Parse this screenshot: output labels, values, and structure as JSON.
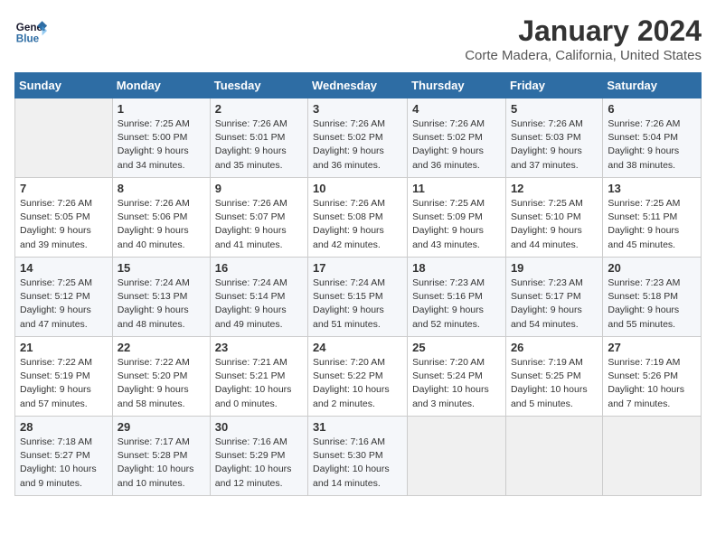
{
  "header": {
    "logo_line1": "General",
    "logo_line2": "Blue",
    "month": "January 2024",
    "location": "Corte Madera, California, United States"
  },
  "days_of_week": [
    "Sunday",
    "Monday",
    "Tuesday",
    "Wednesday",
    "Thursday",
    "Friday",
    "Saturday"
  ],
  "weeks": [
    [
      {
        "num": "",
        "detail": ""
      },
      {
        "num": "1",
        "detail": "Sunrise: 7:25 AM\nSunset: 5:00 PM\nDaylight: 9 hours\nand 34 minutes."
      },
      {
        "num": "2",
        "detail": "Sunrise: 7:26 AM\nSunset: 5:01 PM\nDaylight: 9 hours\nand 35 minutes."
      },
      {
        "num": "3",
        "detail": "Sunrise: 7:26 AM\nSunset: 5:02 PM\nDaylight: 9 hours\nand 36 minutes."
      },
      {
        "num": "4",
        "detail": "Sunrise: 7:26 AM\nSunset: 5:02 PM\nDaylight: 9 hours\nand 36 minutes."
      },
      {
        "num": "5",
        "detail": "Sunrise: 7:26 AM\nSunset: 5:03 PM\nDaylight: 9 hours\nand 37 minutes."
      },
      {
        "num": "6",
        "detail": "Sunrise: 7:26 AM\nSunset: 5:04 PM\nDaylight: 9 hours\nand 38 minutes."
      }
    ],
    [
      {
        "num": "7",
        "detail": "Sunrise: 7:26 AM\nSunset: 5:05 PM\nDaylight: 9 hours\nand 39 minutes."
      },
      {
        "num": "8",
        "detail": "Sunrise: 7:26 AM\nSunset: 5:06 PM\nDaylight: 9 hours\nand 40 minutes."
      },
      {
        "num": "9",
        "detail": "Sunrise: 7:26 AM\nSunset: 5:07 PM\nDaylight: 9 hours\nand 41 minutes."
      },
      {
        "num": "10",
        "detail": "Sunrise: 7:26 AM\nSunset: 5:08 PM\nDaylight: 9 hours\nand 42 minutes."
      },
      {
        "num": "11",
        "detail": "Sunrise: 7:25 AM\nSunset: 5:09 PM\nDaylight: 9 hours\nand 43 minutes."
      },
      {
        "num": "12",
        "detail": "Sunrise: 7:25 AM\nSunset: 5:10 PM\nDaylight: 9 hours\nand 44 minutes."
      },
      {
        "num": "13",
        "detail": "Sunrise: 7:25 AM\nSunset: 5:11 PM\nDaylight: 9 hours\nand 45 minutes."
      }
    ],
    [
      {
        "num": "14",
        "detail": "Sunrise: 7:25 AM\nSunset: 5:12 PM\nDaylight: 9 hours\nand 47 minutes."
      },
      {
        "num": "15",
        "detail": "Sunrise: 7:24 AM\nSunset: 5:13 PM\nDaylight: 9 hours\nand 48 minutes."
      },
      {
        "num": "16",
        "detail": "Sunrise: 7:24 AM\nSunset: 5:14 PM\nDaylight: 9 hours\nand 49 minutes."
      },
      {
        "num": "17",
        "detail": "Sunrise: 7:24 AM\nSunset: 5:15 PM\nDaylight: 9 hours\nand 51 minutes."
      },
      {
        "num": "18",
        "detail": "Sunrise: 7:23 AM\nSunset: 5:16 PM\nDaylight: 9 hours\nand 52 minutes."
      },
      {
        "num": "19",
        "detail": "Sunrise: 7:23 AM\nSunset: 5:17 PM\nDaylight: 9 hours\nand 54 minutes."
      },
      {
        "num": "20",
        "detail": "Sunrise: 7:23 AM\nSunset: 5:18 PM\nDaylight: 9 hours\nand 55 minutes."
      }
    ],
    [
      {
        "num": "21",
        "detail": "Sunrise: 7:22 AM\nSunset: 5:19 PM\nDaylight: 9 hours\nand 57 minutes."
      },
      {
        "num": "22",
        "detail": "Sunrise: 7:22 AM\nSunset: 5:20 PM\nDaylight: 9 hours\nand 58 minutes."
      },
      {
        "num": "23",
        "detail": "Sunrise: 7:21 AM\nSunset: 5:21 PM\nDaylight: 10 hours\nand 0 minutes."
      },
      {
        "num": "24",
        "detail": "Sunrise: 7:20 AM\nSunset: 5:22 PM\nDaylight: 10 hours\nand 2 minutes."
      },
      {
        "num": "25",
        "detail": "Sunrise: 7:20 AM\nSunset: 5:24 PM\nDaylight: 10 hours\nand 3 minutes."
      },
      {
        "num": "26",
        "detail": "Sunrise: 7:19 AM\nSunset: 5:25 PM\nDaylight: 10 hours\nand 5 minutes."
      },
      {
        "num": "27",
        "detail": "Sunrise: 7:19 AM\nSunset: 5:26 PM\nDaylight: 10 hours\nand 7 minutes."
      }
    ],
    [
      {
        "num": "28",
        "detail": "Sunrise: 7:18 AM\nSunset: 5:27 PM\nDaylight: 10 hours\nand 9 minutes."
      },
      {
        "num": "29",
        "detail": "Sunrise: 7:17 AM\nSunset: 5:28 PM\nDaylight: 10 hours\nand 10 minutes."
      },
      {
        "num": "30",
        "detail": "Sunrise: 7:16 AM\nSunset: 5:29 PM\nDaylight: 10 hours\nand 12 minutes."
      },
      {
        "num": "31",
        "detail": "Sunrise: 7:16 AM\nSunset: 5:30 PM\nDaylight: 10 hours\nand 14 minutes."
      },
      {
        "num": "",
        "detail": ""
      },
      {
        "num": "",
        "detail": ""
      },
      {
        "num": "",
        "detail": ""
      }
    ]
  ]
}
